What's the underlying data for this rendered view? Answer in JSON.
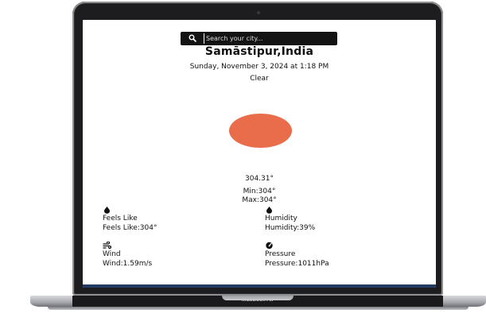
{
  "device": {
    "hinge_label": "MacBook Air"
  },
  "search": {
    "placeholder": "Search your city..."
  },
  "weather": {
    "location": "Samāstipur,India",
    "datetime": "Sunday, November 3, 2024 at 1:18 PM",
    "condition": "Clear",
    "condition_icon": "sun-icon",
    "sun_color": "#e96d4a",
    "temperature": "304.31°",
    "min": "Min:304°",
    "max": "Max:304°"
  },
  "stats": {
    "feels_like": {
      "icon": "drop-icon",
      "title": "Feels Like",
      "value": "Feels Like:304°"
    },
    "humidity": {
      "icon": "drop-icon",
      "title": "Humidity",
      "value": "Humidity:39%"
    },
    "wind": {
      "icon": "wind-icon",
      "title": "Wind",
      "value": "Wind:1.59m/s"
    },
    "pressure": {
      "icon": "gauge-icon",
      "title": "Pressure",
      "value": "Pressure:1011hPa"
    }
  }
}
